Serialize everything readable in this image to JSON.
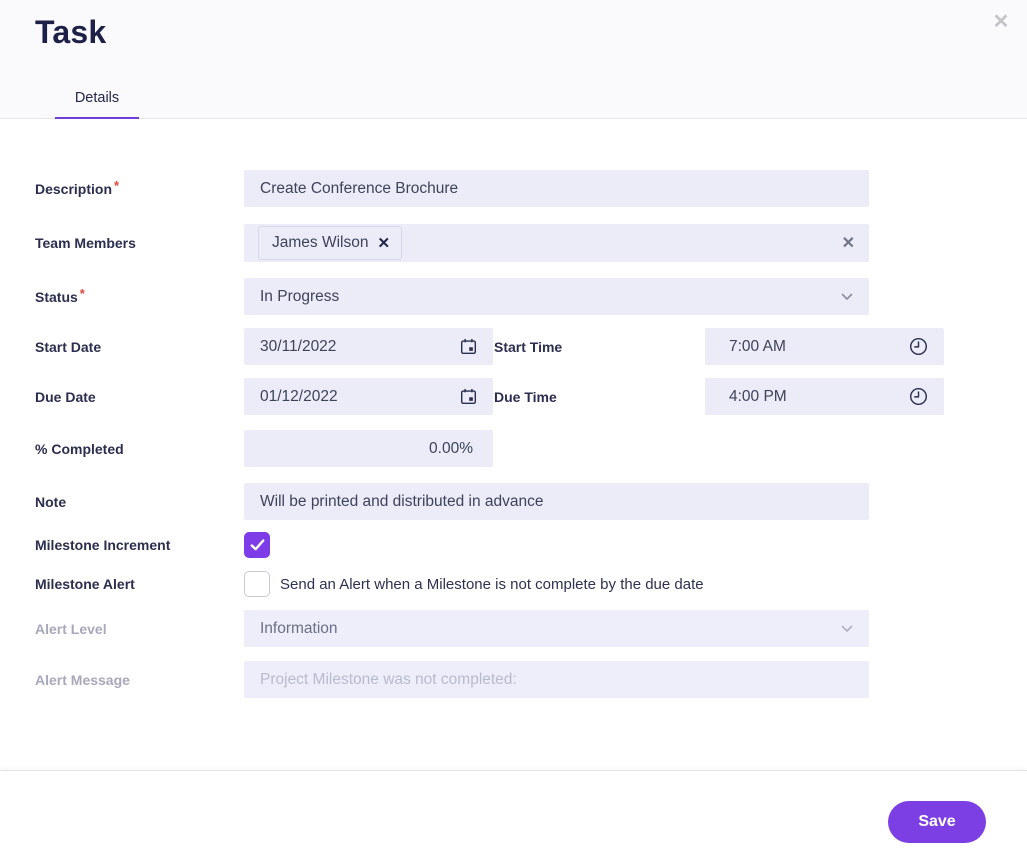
{
  "dialog": {
    "title": "Task"
  },
  "tabs": {
    "details": {
      "label": "Details",
      "active": true
    }
  },
  "icons": {
    "close": "✕",
    "chip_remove": "✕",
    "clear_field": "✕"
  },
  "form": {
    "required_marker": "*",
    "description": {
      "label": "Description",
      "required": true,
      "value": "Create Conference Brochure"
    },
    "team_members": {
      "label": "Team Members",
      "chips": [
        "James Wilson"
      ]
    },
    "status": {
      "label": "Status",
      "required": true,
      "value": "In Progress"
    },
    "start_date": {
      "label": "Start Date",
      "value": "30/11/2022"
    },
    "start_time": {
      "label": "Start Time",
      "value": "7:00 AM"
    },
    "due_date": {
      "label": "Due Date",
      "value": "01/12/2022"
    },
    "due_time": {
      "label": "Due Time",
      "value": "4:00 PM"
    },
    "percent_completed": {
      "label": "% Completed",
      "value": "0.00%"
    },
    "note": {
      "label": "Note",
      "value": "Will be printed and distributed in advance"
    },
    "milestone_increment": {
      "label": "Milestone Increment",
      "checked": true
    },
    "milestone_alert": {
      "label": "Milestone Alert",
      "checked": false,
      "text": "Send an Alert when a Milestone is not complete by the due date"
    },
    "alert_level": {
      "label": "Alert Level",
      "value": "Information",
      "disabled": true
    },
    "alert_message": {
      "label": "Alert Message",
      "placeholder": "Project Milestone was not completed:",
      "disabled": true
    }
  },
  "footer": {
    "save_label": "Save"
  },
  "colors": {
    "accent_purple": "#7b3fe4",
    "checkbox_purple": "#7d3ce8",
    "tab_underline": "#6e3ddc",
    "required_red": "#e0473d",
    "field_background": "#ebecf8",
    "title_navy": "#1e2147"
  }
}
